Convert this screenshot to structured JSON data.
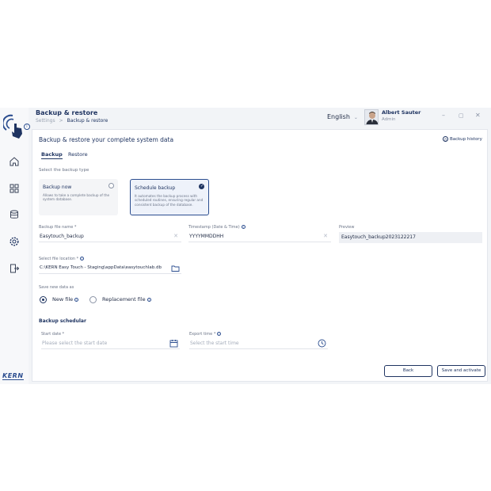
{
  "header": {
    "title": "Backup & restore",
    "breadcrumb": [
      "Settings",
      "Backup & restore"
    ],
    "language": "English",
    "user": {
      "name": "Albert Sauter",
      "role": "Admin"
    }
  },
  "brand": {
    "logo_text": "KERN",
    "accent": "#1f3461"
  },
  "sidebar": {
    "items": [
      {
        "icon": "home-icon"
      },
      {
        "icon": "grid-icon"
      },
      {
        "icon": "database-icon"
      },
      {
        "icon": "settings-icon",
        "active": true
      },
      {
        "icon": "logout-icon"
      }
    ]
  },
  "card": {
    "title": "Backup & restore your complete system data",
    "history_label": "Backup history",
    "tabs": [
      {
        "label": "Backup",
        "active": true
      },
      {
        "label": "Restore",
        "active": false
      }
    ],
    "type_label": "Select the backup type",
    "types": [
      {
        "title": "Backup now",
        "desc": "Allows to take a complete backup of the system database.",
        "selected": false
      },
      {
        "title": "Schedule backup",
        "desc": "It automates the backup process with scheduled routines, ensuring regular and consistent backup of the database.",
        "selected": true
      }
    ],
    "fields": {
      "file_name": {
        "label": "Backup file name *",
        "value": "Easytouch_backup"
      },
      "timestamp": {
        "label": "Timestamp (Date & Time)",
        "value": "YYYYMMDDHH"
      },
      "preview": {
        "label": "Preview",
        "value": "Easytouch_backup2023122217"
      },
      "location": {
        "label": "Select file location *",
        "value": "C:\\KERN Easy Touch - Staging\\appData\\easytouchlab.db"
      }
    },
    "save_as": {
      "label": "Save new data as",
      "options": [
        {
          "label": "New file",
          "selected": true
        },
        {
          "label": "Replacement file",
          "selected": false
        }
      ]
    },
    "scheduler": {
      "title": "Backup schedular",
      "start_date": {
        "label": "Start date *",
        "placeholder": "Please select the start date"
      },
      "export_time": {
        "label": "Export time *",
        "placeholder": "Select the start time"
      }
    },
    "buttons": {
      "back": "Back",
      "save": "Save and activate"
    }
  }
}
